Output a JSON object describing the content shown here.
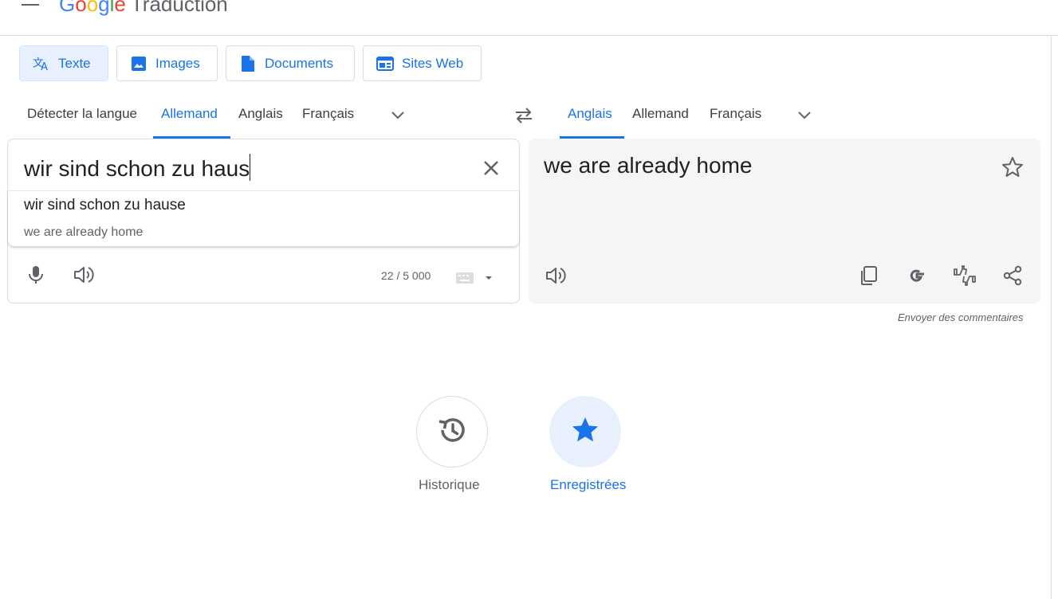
{
  "header": {
    "logo": {
      "G": "G",
      "o1": "o",
      "o2": "o",
      "g": "g",
      "l": "l",
      "e": "e"
    },
    "product": "Traduction"
  },
  "modes": [
    {
      "label": "Texte",
      "icon": "translate-icon",
      "active": true
    },
    {
      "label": "Images",
      "icon": "image-icon",
      "active": false
    },
    {
      "label": "Documents",
      "icon": "document-icon",
      "active": false
    },
    {
      "label": "Sites Web",
      "icon": "website-icon",
      "active": false
    }
  ],
  "source_langs": {
    "items": [
      "Détecter la langue",
      "Allemand",
      "Anglais",
      "Français"
    ],
    "selected": "Allemand"
  },
  "target_langs": {
    "items": [
      "Anglais",
      "Allemand",
      "Français"
    ],
    "selected": "Anglais"
  },
  "source": {
    "text": "wir sind schon zu haus",
    "suggestion": "wir sind schon zu hause",
    "suggestion_translation": "we are already home",
    "char_count": "22 / 5 000"
  },
  "target": {
    "text": "we are already home"
  },
  "feedback": "Envoyer des commentaires",
  "bottom": {
    "history_label": "Historique",
    "saved_label": "Enregistrées"
  },
  "colors": {
    "accent": "#1a73e8",
    "accent_bg": "#e8f0fe",
    "text": "#202124",
    "muted": "#5f6368",
    "target_bg": "#f5f5f5"
  }
}
